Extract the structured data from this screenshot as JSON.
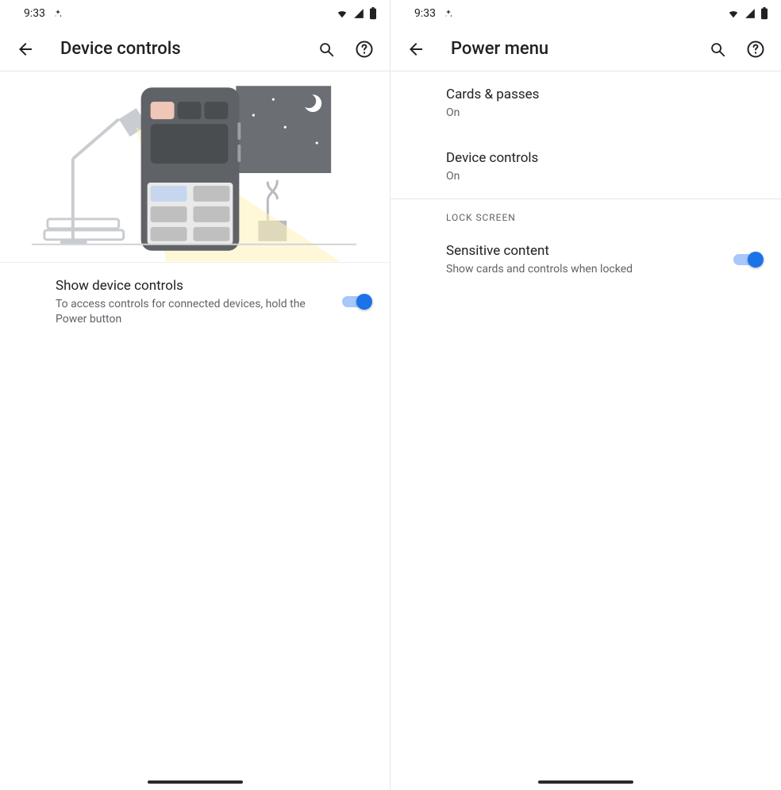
{
  "left": {
    "status": {
      "time": "9:33"
    },
    "appbar": {
      "title": "Device controls"
    },
    "setting": {
      "title": "Show device controls",
      "subtitle": "To access controls for connected devices, hold the Power button",
      "enabled": true
    }
  },
  "right": {
    "status": {
      "time": "9:33"
    },
    "appbar": {
      "title": "Power menu"
    },
    "items": [
      {
        "title": "Cards & passes",
        "subtitle": "On"
      },
      {
        "title": "Device controls",
        "subtitle": "On"
      }
    ],
    "section_label": "LOCK SCREEN",
    "sensitive": {
      "title": "Sensitive content",
      "subtitle": "Show cards and controls when locked",
      "enabled": true
    }
  },
  "icons": {
    "back": "back-arrow-icon",
    "search": "search-icon",
    "help": "help-icon",
    "wifi": "wifi-icon",
    "signal": "signal-icon",
    "battery": "battery-icon",
    "sparkle": "sparkle-icon"
  }
}
